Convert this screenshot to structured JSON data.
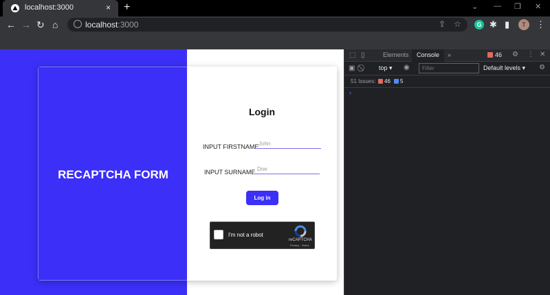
{
  "browser": {
    "tab_title": "localhost:3000",
    "close_glyph": "×",
    "new_tab_glyph": "+",
    "window_controls": [
      "⌄",
      "—",
      "❐",
      "✕"
    ],
    "nav": {
      "back": "←",
      "forward": "→",
      "reload": "↻",
      "home": "⌂"
    },
    "url_host": "localhost",
    "url_port": ":3000",
    "avatar_letter": "T"
  },
  "form": {
    "banner_title": "RECAPTCHA FORM",
    "login_title": "Login",
    "firstname_label": "INPUT FIRSTNAME",
    "firstname_placeholder": "John",
    "surname_label": "INPUT SURNAME",
    "surname_placeholder": "Doe",
    "login_button": "Log in",
    "colors": {
      "accent": "#3b2ff8"
    }
  },
  "recaptcha": {
    "label": "I'm not a robot",
    "brand": "reCAPTCHA",
    "links": "Privacy - Terms"
  },
  "devtools": {
    "tabs": [
      "Elements",
      "Console"
    ],
    "active_tab": "Console",
    "more_tabs": "»",
    "error_count": "46",
    "context": "top ▾",
    "filter_placeholder": "Filter",
    "levels": "Default levels ▾",
    "issues_label": "51 Issues:",
    "issues_errors": "46",
    "issues_info": "5",
    "prompt": "›"
  }
}
